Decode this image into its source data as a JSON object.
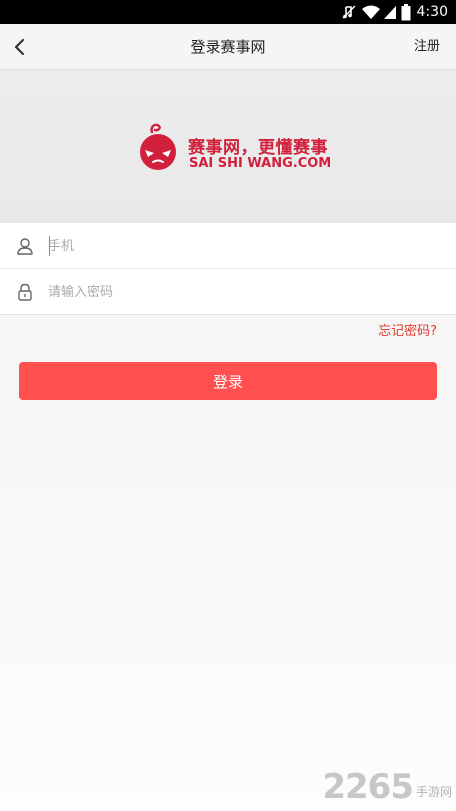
{
  "status_bar": {
    "time": "4:30",
    "icons": [
      "mute-icon",
      "wifi-icon",
      "signal-icon",
      "battery-icon"
    ]
  },
  "nav": {
    "back_icon": "chevron-left-icon",
    "title": "登录赛事网",
    "register_label": "注册"
  },
  "logo": {
    "slogan": "赛事网，更懂赛事",
    "domain": "SAI SHI WANG.COM",
    "brand_color": "#d0203b"
  },
  "form": {
    "phone": {
      "icon": "user-icon",
      "placeholder": "手机",
      "value": ""
    },
    "password": {
      "icon": "lock-icon",
      "placeholder": "请输入密码",
      "value": ""
    }
  },
  "forgot_password_label": "忘记密码?",
  "login_button_label": "登录",
  "colors": {
    "accent": "#ff4f4f",
    "link_red": "#e03a2f"
  },
  "watermark": {
    "number": "2265",
    "suffix": "手游网"
  }
}
